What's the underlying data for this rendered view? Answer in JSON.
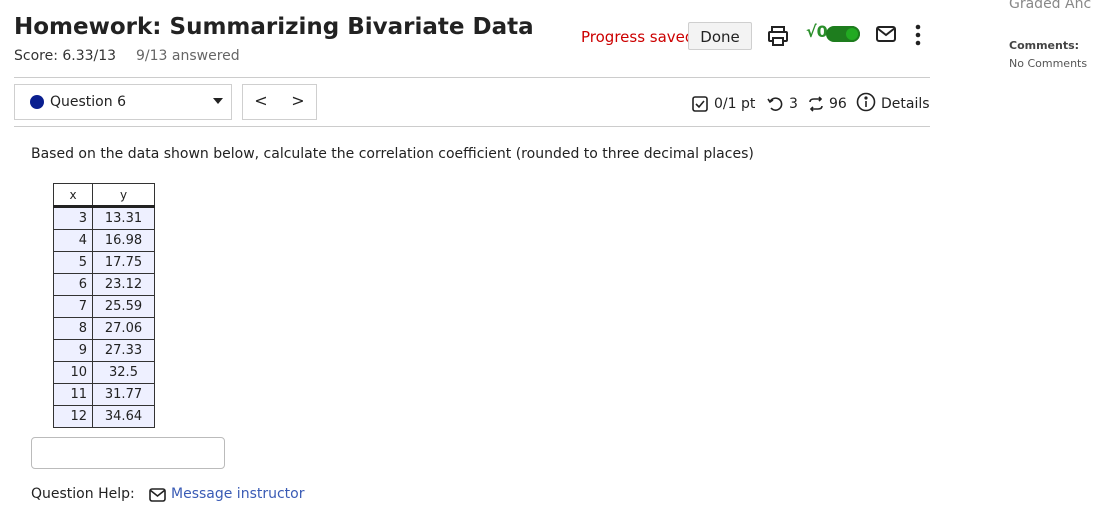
{
  "header": {
    "title": "Homework: Summarizing Bivariate Data",
    "score": "Score: 6.33/13",
    "answered": "9/13 answered",
    "progress_saved": "Progress saved",
    "done_label": "Done",
    "sqrt_label": "√0"
  },
  "question_nav": {
    "selected": "Question 6",
    "prev": "<",
    "next": ">"
  },
  "question_meta": {
    "points": "0/1 pt",
    "retries": "3",
    "attempts": "96",
    "details": "Details"
  },
  "question": {
    "text": "Based on the data shown below, calculate the correlation coefficient (rounded to three decimal places)",
    "table": {
      "headers": [
        "x",
        "y"
      ],
      "rows": [
        [
          "3",
          "13.31"
        ],
        [
          "4",
          "16.98"
        ],
        [
          "5",
          "17.75"
        ],
        [
          "6",
          "23.12"
        ],
        [
          "7",
          "25.59"
        ],
        [
          "8",
          "27.06"
        ],
        [
          "9",
          "27.33"
        ],
        [
          "10",
          "32.5"
        ],
        [
          "11",
          "31.77"
        ],
        [
          "12",
          "34.64"
        ]
      ]
    },
    "answer_value": ""
  },
  "help": {
    "label": "Question Help:",
    "message_link": "Message instructor"
  },
  "side_panel": {
    "heading": "Graded Anc",
    "comments_label": "Comments:",
    "comments_value": "No Comments"
  },
  "colors": {
    "progress_saved": "#cc0000",
    "link": "#3a5bb5",
    "toggle_on": "#22aa22",
    "question_dot": "#0a1f8f",
    "table_row_bg": "#eef0ff"
  }
}
